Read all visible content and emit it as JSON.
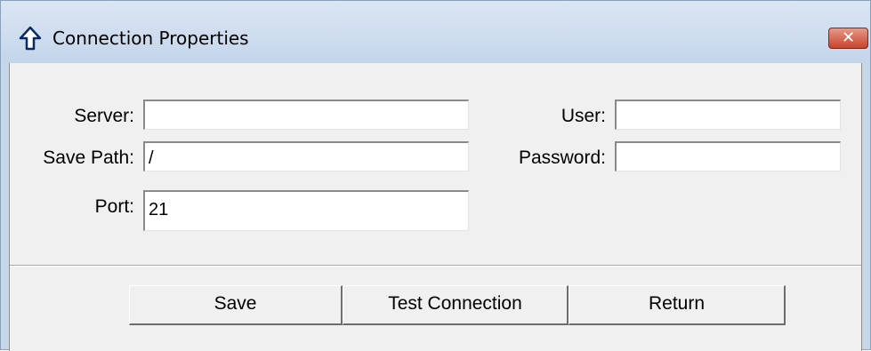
{
  "window": {
    "title": "Connection Properties",
    "close_glyph": "✕"
  },
  "form": {
    "server": {
      "label": "Server:",
      "value": ""
    },
    "save_path": {
      "label": "Save Path:",
      "value": "/"
    },
    "port": {
      "label": "Port:",
      "value": "21"
    },
    "user": {
      "label": "User:",
      "value": ""
    },
    "password": {
      "label": "Password:",
      "value": ""
    }
  },
  "buttons": {
    "save": "Save",
    "test": "Test Connection",
    "return": "Return"
  },
  "icons": {
    "title": "up-arrow-icon",
    "close": "close-icon"
  }
}
